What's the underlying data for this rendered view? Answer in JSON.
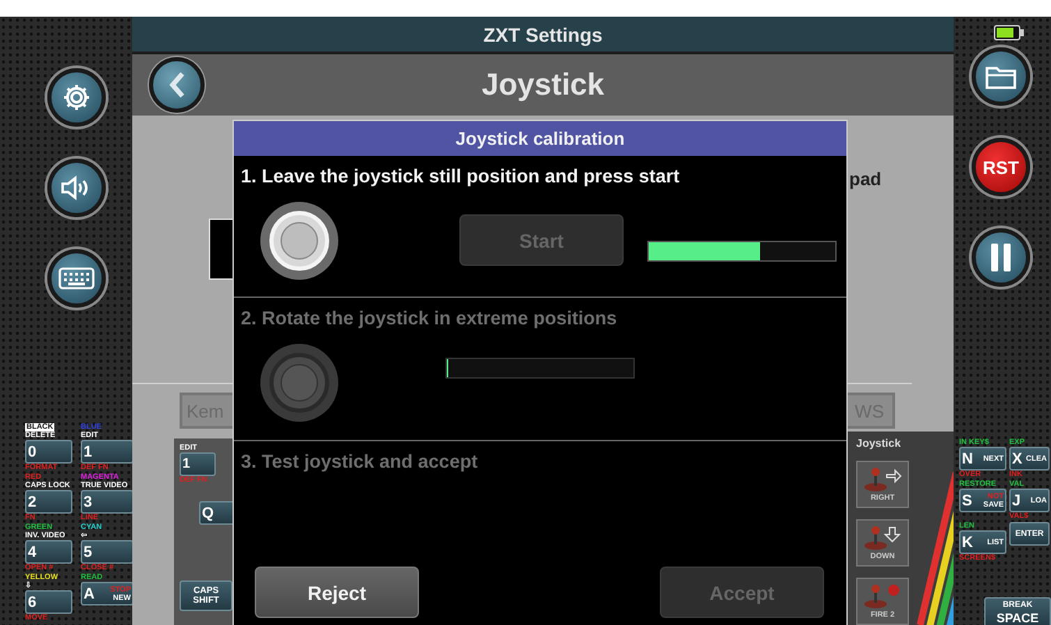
{
  "top_bar": {
    "title": "ZXT Settings"
  },
  "header": {
    "title": "Joystick"
  },
  "left_rail": {
    "buttons": [
      {
        "kind": "settings"
      },
      {
        "kind": "sound"
      },
      {
        "kind": "keyboard"
      }
    ],
    "keys": [
      {
        "main": "0",
        "top": [
          {
            "text": "BLACK",
            "color": "#ffffff",
            "boxed": true
          },
          {
            "text": "DELETE",
            "boxed": false
          }
        ],
        "bottom": "FORMAT"
      },
      {
        "main": "1",
        "top": [
          {
            "text": "BLUE",
            "color": "#3040e0",
            "boxed": false
          },
          {
            "text": "EDIT",
            "color": "#ffffff",
            "boxed": false
          }
        ],
        "bottom": "DEF FN"
      },
      {
        "main": "2",
        "top": [
          {
            "text": "RED",
            "color": "#e02020",
            "boxed": false
          },
          {
            "text": "CAPS LOCK",
            "color": "#ffffff",
            "boxed": false
          }
        ],
        "bottom": "FN"
      },
      {
        "main": "3",
        "top": [
          {
            "text": "MAGENTA",
            "color": "#e020e0",
            "boxed": false
          },
          {
            "text": "TRUE VIDEO",
            "color": "#ffffff",
            "boxed": false
          }
        ],
        "bottom": "LINE"
      },
      {
        "main": "4",
        "top": [
          {
            "text": "GREEN",
            "color": "#20c040",
            "boxed": false
          },
          {
            "text": "INV. VIDEO",
            "color": "#ffffff",
            "boxed": false
          }
        ],
        "bottom": "OPEN #"
      },
      {
        "main": "5",
        "top": [
          {
            "text": "CYAN",
            "color": "#20d0d0",
            "boxed": false
          },
          {
            "text": "⇦",
            "color": "#ffffff",
            "boxed": false
          }
        ],
        "bottom": "CLOSE #"
      },
      {
        "main": "6",
        "top": [
          {
            "text": "YELLOW",
            "color": "#e8e020",
            "boxed": false
          },
          {
            "text": "⇩",
            "color": "#ffffff",
            "boxed": false
          }
        ],
        "bottom": "MOVE"
      },
      {
        "main": "A",
        "top": [
          {
            "text": "READ",
            "color": "#20c040",
            "boxed": false
          }
        ],
        "inner": [
          {
            "text": "STOP",
            "color": "#e02020"
          },
          {
            "text": "NEW",
            "color": "#ffffff"
          }
        ]
      }
    ]
  },
  "right_rail": {
    "buttons": [
      {
        "kind": "folder"
      },
      {
        "kind": "reset",
        "label": "RST"
      },
      {
        "kind": "pause"
      }
    ],
    "keys": [
      {
        "main": "N",
        "top": [
          {
            "text": "IN KEY$",
            "color": "#20c040",
            "boxed": false
          }
        ],
        "inner": [
          {
            "text": "NEXT",
            "color": "#ffffff"
          }
        ],
        "bottom": "OVER"
      },
      {
        "main": "X",
        "top": [
          {
            "text": "EXP",
            "color": "#20c040",
            "boxed": false
          }
        ],
        "inner": [
          {
            "text": "CLEA",
            "color": "#ffffff"
          }
        ],
        "bottom": "INK"
      },
      {
        "main": "S",
        "top": [
          {
            "text": "RESTORE",
            "color": "#20c040",
            "boxed": false
          }
        ],
        "inner": [
          {
            "text": "NOT",
            "color": "#e02020"
          },
          {
            "text": "SAVE",
            "color": "#ffffff"
          }
        ]
      },
      {
        "main": "J",
        "top": [
          {
            "text": "VAL",
            "color": "#20c040",
            "boxed": false
          }
        ],
        "inner": [
          {
            "text": "LOA",
            "color": "#ffffff"
          }
        ],
        "bottom": "VAL$"
      },
      {
        "main": "K",
        "top": [
          {
            "text": "LEN",
            "color": "#20c040",
            "boxed": false
          }
        ],
        "inner": [
          {
            "text": "LIST",
            "color": "#ffffff"
          }
        ],
        "bottom": "SCREEN$"
      },
      {
        "main": "ENTER"
      }
    ],
    "space_key": [
      "BREAK",
      "SPACE"
    ]
  },
  "background": {
    "heading_fragment": "pad",
    "left_button": "Kem",
    "right_button": "WS"
  },
  "keyboard_panel": {
    "label": "EDIT",
    "key": "1",
    "key_bottom": "DEF FN",
    "q_key": "Q",
    "shift_key": [
      "CAPS",
      "SHIFT"
    ]
  },
  "joystick_panel": {
    "title": "Joystick",
    "buttons": [
      {
        "kind": "right",
        "label": "RIGHT"
      },
      {
        "kind": "down",
        "label": "DOWN"
      },
      {
        "kind": "fire",
        "label": "FIRE 2"
      }
    ]
  },
  "dialog": {
    "title": "Joystick calibration",
    "steps": [
      {
        "kind": "start",
        "text": "1. Leave the joystick still position and press start",
        "active": true,
        "button": "Start",
        "button_disabled": true,
        "level": 0.6
      },
      {
        "kind": "rotate",
        "text": "2. Rotate the joystick in extreme positions",
        "active": false,
        "level": 0
      },
      {
        "kind": "test",
        "text": "3. Test joystick and accept",
        "active": false
      }
    ],
    "buttons": [
      {
        "label": "Reject",
        "disabled": false
      },
      {
        "label": "Accept",
        "disabled": true
      }
    ]
  }
}
